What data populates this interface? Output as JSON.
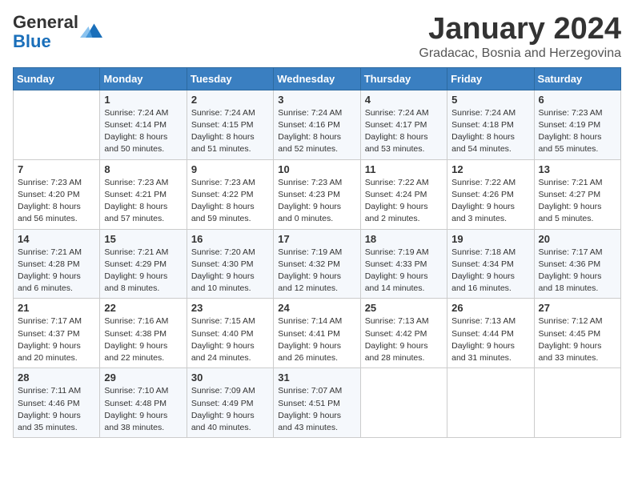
{
  "header": {
    "logo_line1": "General",
    "logo_line2": "Blue",
    "month_title": "January 2024",
    "location": "Gradacac, Bosnia and Herzegovina"
  },
  "days_of_week": [
    "Sunday",
    "Monday",
    "Tuesday",
    "Wednesday",
    "Thursday",
    "Friday",
    "Saturday"
  ],
  "weeks": [
    [
      {
        "day": "",
        "info": ""
      },
      {
        "day": "1",
        "info": "Sunrise: 7:24 AM\nSunset: 4:14 PM\nDaylight: 8 hours\nand 50 minutes."
      },
      {
        "day": "2",
        "info": "Sunrise: 7:24 AM\nSunset: 4:15 PM\nDaylight: 8 hours\nand 51 minutes."
      },
      {
        "day": "3",
        "info": "Sunrise: 7:24 AM\nSunset: 4:16 PM\nDaylight: 8 hours\nand 52 minutes."
      },
      {
        "day": "4",
        "info": "Sunrise: 7:24 AM\nSunset: 4:17 PM\nDaylight: 8 hours\nand 53 minutes."
      },
      {
        "day": "5",
        "info": "Sunrise: 7:24 AM\nSunset: 4:18 PM\nDaylight: 8 hours\nand 54 minutes."
      },
      {
        "day": "6",
        "info": "Sunrise: 7:23 AM\nSunset: 4:19 PM\nDaylight: 8 hours\nand 55 minutes."
      }
    ],
    [
      {
        "day": "7",
        "info": "Sunrise: 7:23 AM\nSunset: 4:20 PM\nDaylight: 8 hours\nand 56 minutes."
      },
      {
        "day": "8",
        "info": "Sunrise: 7:23 AM\nSunset: 4:21 PM\nDaylight: 8 hours\nand 57 minutes."
      },
      {
        "day": "9",
        "info": "Sunrise: 7:23 AM\nSunset: 4:22 PM\nDaylight: 8 hours\nand 59 minutes."
      },
      {
        "day": "10",
        "info": "Sunrise: 7:23 AM\nSunset: 4:23 PM\nDaylight: 9 hours\nand 0 minutes."
      },
      {
        "day": "11",
        "info": "Sunrise: 7:22 AM\nSunset: 4:24 PM\nDaylight: 9 hours\nand 2 minutes."
      },
      {
        "day": "12",
        "info": "Sunrise: 7:22 AM\nSunset: 4:26 PM\nDaylight: 9 hours\nand 3 minutes."
      },
      {
        "day": "13",
        "info": "Sunrise: 7:21 AM\nSunset: 4:27 PM\nDaylight: 9 hours\nand 5 minutes."
      }
    ],
    [
      {
        "day": "14",
        "info": "Sunrise: 7:21 AM\nSunset: 4:28 PM\nDaylight: 9 hours\nand 6 minutes."
      },
      {
        "day": "15",
        "info": "Sunrise: 7:21 AM\nSunset: 4:29 PM\nDaylight: 9 hours\nand 8 minutes."
      },
      {
        "day": "16",
        "info": "Sunrise: 7:20 AM\nSunset: 4:30 PM\nDaylight: 9 hours\nand 10 minutes."
      },
      {
        "day": "17",
        "info": "Sunrise: 7:19 AM\nSunset: 4:32 PM\nDaylight: 9 hours\nand 12 minutes."
      },
      {
        "day": "18",
        "info": "Sunrise: 7:19 AM\nSunset: 4:33 PM\nDaylight: 9 hours\nand 14 minutes."
      },
      {
        "day": "19",
        "info": "Sunrise: 7:18 AM\nSunset: 4:34 PM\nDaylight: 9 hours\nand 16 minutes."
      },
      {
        "day": "20",
        "info": "Sunrise: 7:17 AM\nSunset: 4:36 PM\nDaylight: 9 hours\nand 18 minutes."
      }
    ],
    [
      {
        "day": "21",
        "info": "Sunrise: 7:17 AM\nSunset: 4:37 PM\nDaylight: 9 hours\nand 20 minutes."
      },
      {
        "day": "22",
        "info": "Sunrise: 7:16 AM\nSunset: 4:38 PM\nDaylight: 9 hours\nand 22 minutes."
      },
      {
        "day": "23",
        "info": "Sunrise: 7:15 AM\nSunset: 4:40 PM\nDaylight: 9 hours\nand 24 minutes."
      },
      {
        "day": "24",
        "info": "Sunrise: 7:14 AM\nSunset: 4:41 PM\nDaylight: 9 hours\nand 26 minutes."
      },
      {
        "day": "25",
        "info": "Sunrise: 7:13 AM\nSunset: 4:42 PM\nDaylight: 9 hours\nand 28 minutes."
      },
      {
        "day": "26",
        "info": "Sunrise: 7:13 AM\nSunset: 4:44 PM\nDaylight: 9 hours\nand 31 minutes."
      },
      {
        "day": "27",
        "info": "Sunrise: 7:12 AM\nSunset: 4:45 PM\nDaylight: 9 hours\nand 33 minutes."
      }
    ],
    [
      {
        "day": "28",
        "info": "Sunrise: 7:11 AM\nSunset: 4:46 PM\nDaylight: 9 hours\nand 35 minutes."
      },
      {
        "day": "29",
        "info": "Sunrise: 7:10 AM\nSunset: 4:48 PM\nDaylight: 9 hours\nand 38 minutes."
      },
      {
        "day": "30",
        "info": "Sunrise: 7:09 AM\nSunset: 4:49 PM\nDaylight: 9 hours\nand 40 minutes."
      },
      {
        "day": "31",
        "info": "Sunrise: 7:07 AM\nSunset: 4:51 PM\nDaylight: 9 hours\nand 43 minutes."
      },
      {
        "day": "",
        "info": ""
      },
      {
        "day": "",
        "info": ""
      },
      {
        "day": "",
        "info": ""
      }
    ]
  ]
}
